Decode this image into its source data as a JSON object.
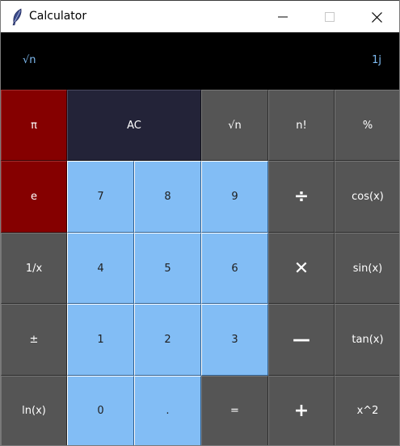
{
  "window": {
    "title": "Calculator",
    "icon": "feather-icon",
    "controls": [
      "minimize-icon",
      "maximize-icon",
      "close-icon"
    ]
  },
  "display": {
    "expression": "√n",
    "result": "1j"
  },
  "buttons": {
    "pi": "π",
    "ac": "AC",
    "sqrt": "√n",
    "factorial": "n!",
    "percent": "%",
    "e": "e",
    "seven": "7",
    "eight": "8",
    "nine": "9",
    "divide": "÷",
    "cos": "cos(x)",
    "reciprocal": "1/x",
    "four": "4",
    "five": "5",
    "six": "6",
    "multiply": "✕",
    "sin": "sin(x)",
    "plus_minus": "±",
    "one": "1",
    "two": "2",
    "three": "3",
    "minus": "—",
    "tan": "tan(x)",
    "ln": "ln(x)",
    "zero": "0",
    "dot": ".",
    "equals": "=",
    "plus": "+",
    "square": "x^2"
  },
  "colors": {
    "display_bg": "#000000",
    "display_text": "#7fbcf3",
    "operator_gray": "#555555",
    "constant_red": "#850000",
    "clear_navy": "#232338",
    "digit_blue": "#82bdf5"
  }
}
